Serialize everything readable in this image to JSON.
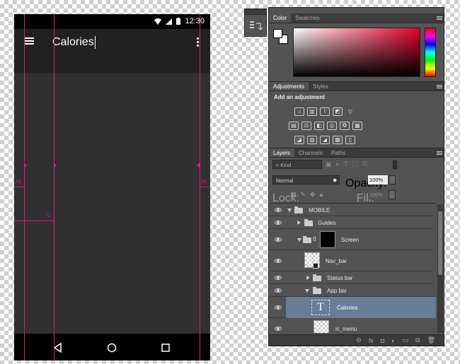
{
  "phone": {
    "status_bar": {
      "time": "12:30",
      "icons": [
        "wifi-icon",
        "signal-icon",
        "battery-icon"
      ]
    },
    "app_bar": {
      "title": "Calories",
      "menu_icon": "hamburger-icon",
      "overflow_icon": "overflow-menu-icon"
    },
    "nav_bar": {
      "icons": [
        "back-icon",
        "home-icon",
        "recents-icon"
      ]
    },
    "guides": {
      "left_margin": "16",
      "right_margin": "16",
      "keyline": "72"
    },
    "colors": {
      "app_bar": "#212121",
      "body": "#303030",
      "status": "#000000",
      "guide": "#e8127f"
    }
  },
  "photoshop": {
    "color_panel": {
      "tabs": [
        "Color",
        "Swatches"
      ]
    },
    "adjustments_panel": {
      "tabs": [
        "Adjustments",
        "Styles"
      ],
      "heading": "Add an adjustment"
    },
    "layers_panel": {
      "tabs": [
        "Layers",
        "Channels",
        "Paths"
      ],
      "filter_kind": "Kind",
      "blend_mode": "Normal",
      "opacity_label": "Opacity:",
      "opacity_value": "100%",
      "lock_label": "Lock:",
      "fill_label": "Fill:",
      "fill_value": "100%",
      "layers": [
        {
          "name": "MOBILE",
          "type": "group",
          "expanded": true,
          "indent": 0
        },
        {
          "name": "Guides",
          "type": "group",
          "expanded": false,
          "indent": 1
        },
        {
          "name": "Screen",
          "type": "masked-group",
          "expanded": true,
          "indent": 1
        },
        {
          "name": "Nav_bar",
          "type": "smart-object",
          "indent": 2
        },
        {
          "name": "Status bar",
          "type": "group",
          "expanded": false,
          "indent": 2
        },
        {
          "name": "App bar",
          "type": "group",
          "expanded": true,
          "indent": 2
        },
        {
          "name": "Calories",
          "type": "text",
          "indent": 3,
          "selected": true
        },
        {
          "name": "ic_menu",
          "type": "smart-object",
          "indent": 3
        }
      ]
    }
  }
}
